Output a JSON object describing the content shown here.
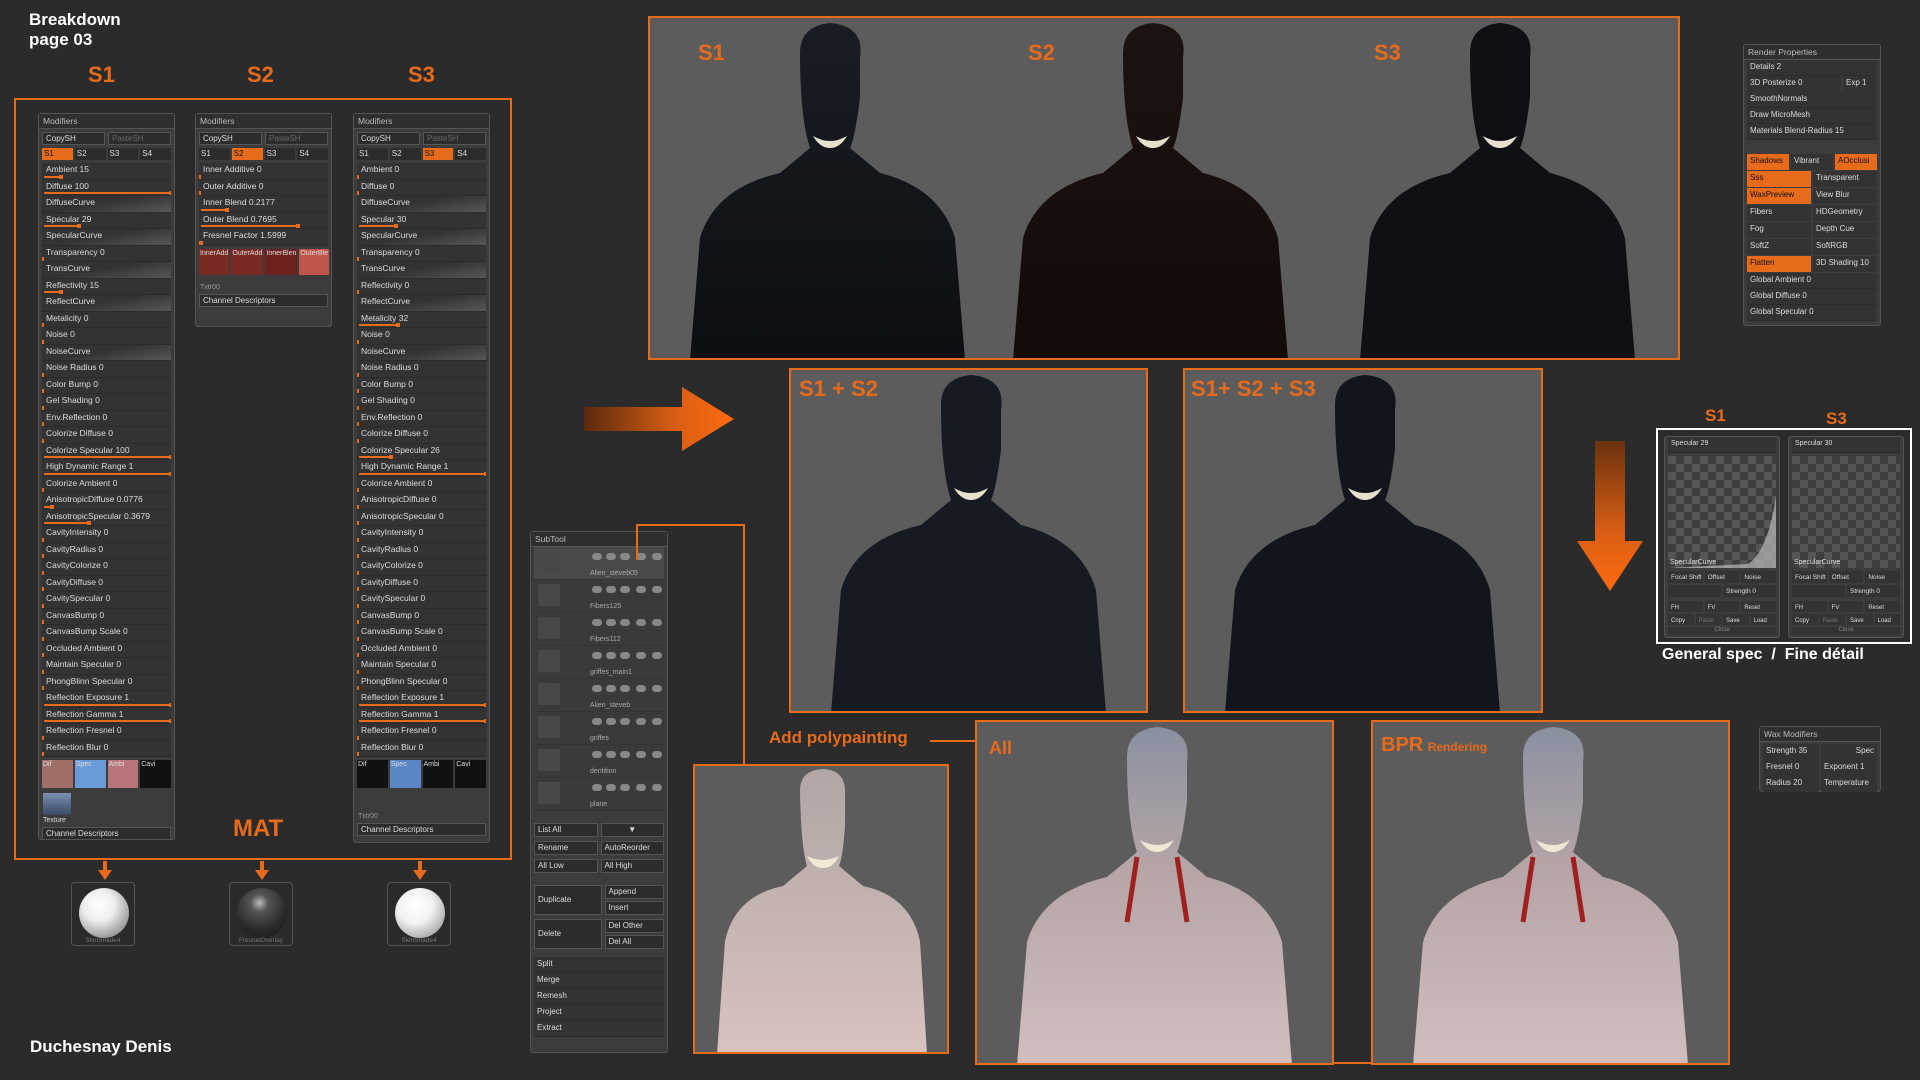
{
  "header": {
    "title": "Breakdown",
    "page": "page 03",
    "author": "Duchesnay Denis"
  },
  "labels": {
    "s1": "S1",
    "s2": "S2",
    "s3": "S3",
    "mat": "MAT",
    "s1s2": "S1 + S2",
    "s1s2s3": "S1+ S2 + S3",
    "add_poly": "Add polypainting",
    "all": "All",
    "bpr": "BPR",
    "rendering": "Rendering",
    "general_spec": "General spec  /  Fine détail"
  },
  "modifiers": {
    "title": "Modifiers",
    "copy_label": "CopySH",
    "paste_label": "PasteSH",
    "tab_labels": [
      "S1",
      "S2",
      "S3",
      "S4"
    ],
    "s1_rows": [
      "Ambient 15",
      "Diffuse 100",
      "DiffuseCurve",
      "Specular 29",
      "SpecularCurve",
      "Transparency 0",
      "TransCurve",
      "Reflectivity 15",
      "ReflectCurve",
      "Metalicity 0",
      "Noise 0",
      "NoiseCurve",
      "Noise Radius 0",
      "Color Bump 0",
      "Gel Shading 0",
      "Env.Reflection 0",
      "Colorize Diffuse 0",
      "Colorize Specular 100",
      "High Dynamic Range 1",
      "Colorize Ambient 0",
      "AnisotropicDiffuse 0.0776",
      "AnisotropicSpecular 0.3679",
      "CavityIntensity 0",
      "CavityRadius 0",
      "CavityColorize 0",
      "CavityDiffuse 0",
      "CavitySpecular 0",
      "CanvasBump 0",
      "CanvasBump Scale 0",
      "Occluded Ambient 0",
      "Maintain Specular 0",
      "PhongBlinn Specular 0",
      "Reflection Exposure 1",
      "Reflection Gamma 1",
      "Reflection Fresnel 0",
      "Reflection Blur 0"
    ],
    "s1_swatches": [
      "Dif",
      "Spec",
      "Ambi",
      "Cavi"
    ],
    "s1_texture": "Texture",
    "channel_label": "Channel Descriptors",
    "s2_rows": [
      "Inner Additive 0",
      "Outer Additive 0",
      "Inner Blend 0.2177",
      "Outer Blend 0.7695",
      "Fresnel Factor 1.5999"
    ],
    "s2_swatches": [
      "InnerAdd",
      "OuterAdd",
      "InnerBlen",
      "OuterBle"
    ],
    "s2_txtr": "Txtr00",
    "s3_rows": [
      "Ambient 0",
      "Diffuse 0",
      "DiffuseCurve",
      "Specular 30",
      "SpecularCurve",
      "Transparency 0",
      "TransCurve",
      "Reflectivity 0",
      "ReflectCurve",
      "Metalicity 32",
      "Noise 0",
      "NoiseCurve",
      "Noise Radius 0",
      "Color Bump 0",
      "Gel Shading 0",
      "Env.Reflection 0",
      "Colorize Diffuse 0",
      "Colorize Specular 26",
      "High Dynamic Range 1",
      "Colorize Ambient 0",
      "AnisotropicDiffuse 0",
      "AnisotropicSpecular 0",
      "CavityIntensity 0",
      "CavityRadius 0",
      "CavityColorize 0",
      "CavityDiffuse 0",
      "CavitySpecular 0",
      "CanvasBump 0",
      "CanvasBump Scale 0",
      "Occluded Ambient 0",
      "Maintain Specular 0",
      "PhongBlinn Specular 0",
      "Reflection Exposure 1",
      "Reflection Gamma 1",
      "Reflection Fresnel 0",
      "Reflection Blur 0"
    ],
    "s3_swatches": [
      "Dif",
      "Spec",
      "Ambi",
      "Cavi"
    ],
    "s3_txtr": "Txtr00"
  },
  "spheres": [
    "SkinShade4",
    "FresnelOverlay",
    "SkinShade4"
  ],
  "subtool": {
    "title": "SubTool",
    "items": [
      "Alien_steveb05",
      "Fibers125",
      "Fibers112",
      "griffes_main1",
      "Alien_steveb",
      "griffes",
      "dentition",
      "plane"
    ],
    "buttons": [
      [
        "List All",
        ""
      ],
      [
        "Rename",
        "AutoReorder"
      ],
      [
        "All Low",
        "All High"
      ],
      [
        "Duplicate",
        "Append"
      ],
      [
        "",
        "Insert"
      ],
      [
        "Delete",
        "Del Other"
      ],
      [
        "",
        "Del All"
      ]
    ],
    "actions": [
      "Split",
      "Merge",
      "Remesh",
      "Project",
      "Extract"
    ]
  },
  "render_props": {
    "title": "Render Properties",
    "details": "Details 2",
    "posterize": "3D Posterize 0",
    "exp": "Exp 1",
    "smooth": "SmoothNormals",
    "micromesh": "Draw MicroMesh",
    "materials_blend": "Materials Blend-Radius 15",
    "toggles": [
      [
        "Shadows",
        "Vibrant",
        "AOcclusi"
      ],
      [
        "Sss",
        "Transparent"
      ],
      [
        "WaxPreview",
        "View Blur"
      ],
      [
        "Fibers",
        "HDGeometry"
      ],
      [
        "Fog",
        "Depth Cue"
      ],
      [
        "SoftZ",
        "SoftRGB"
      ],
      [
        "Flatten",
        "3D Shading 10"
      ]
    ],
    "globals": [
      "Global Ambient 0",
      "Global Diffuse 0",
      "Global Specular 0"
    ]
  },
  "spec_panels": [
    {
      "label": "S1",
      "title": "Specular 29",
      "curve": "SpecularCurve",
      "row1": [
        "Focal Shift 0",
        "Offset",
        "Noise"
      ],
      "row2": [
        "Strength 0"
      ],
      "buttons": [
        "FH",
        "FV",
        "Reset",
        "Copy",
        "Paste",
        "Save",
        "Load"
      ],
      "footer": "Close"
    },
    {
      "label": "S3",
      "title": "Specular 30",
      "curve": "SpecularCurve",
      "row1": [
        "Focal Shift 0",
        "Offset",
        "Noise"
      ],
      "row2": [
        "Strength 0"
      ],
      "buttons": [
        "FH",
        "FV",
        "Reset",
        "Copy",
        "Paste",
        "Save",
        "Load"
      ],
      "footer": "Close"
    }
  ],
  "wax": {
    "title": "Wax Modifiers",
    "rows": [
      [
        "Strength 35",
        "Spec"
      ],
      [
        "Fresnel 0",
        "Exponent 1"
      ],
      [
        "Radius 20",
        "Temperature"
      ]
    ]
  },
  "colors": {
    "accent": "#e86a1b",
    "background": "#2b2b2b",
    "panel": "#3c3c3c"
  }
}
